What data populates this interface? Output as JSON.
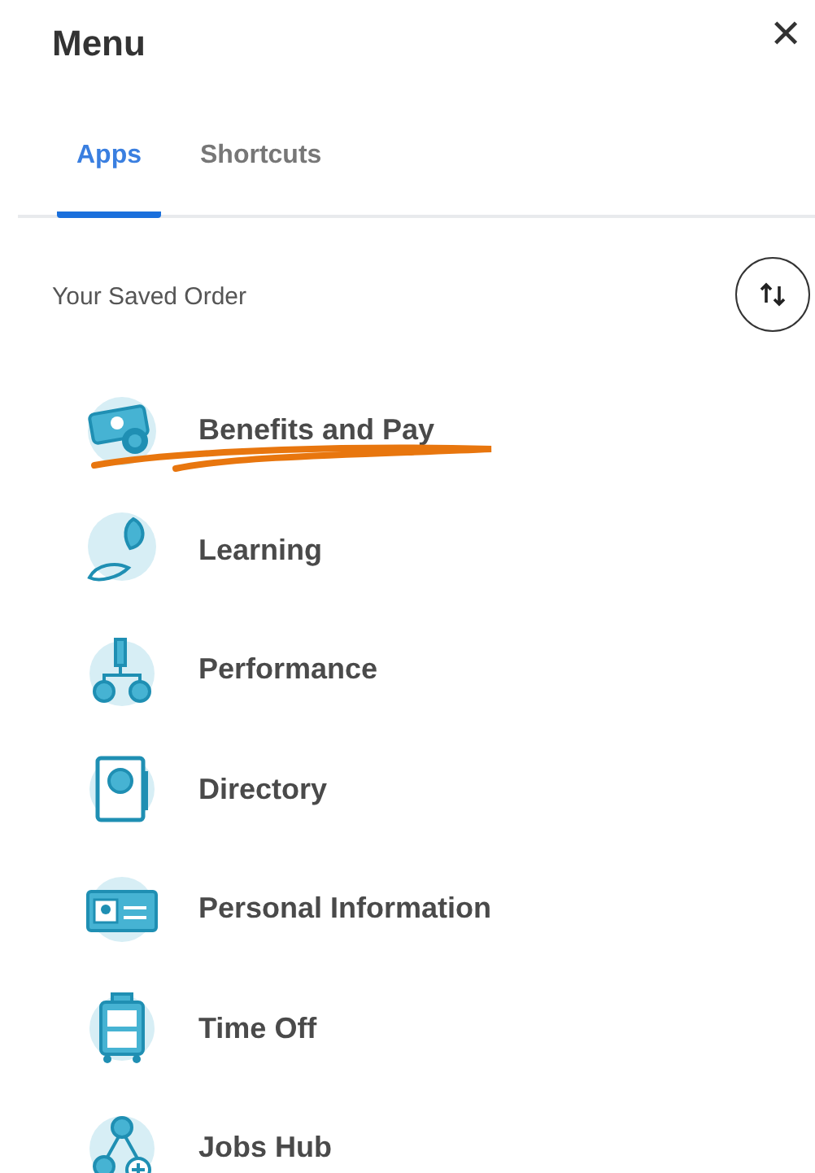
{
  "header": {
    "title": "Menu",
    "close": "✕"
  },
  "tabs": [
    {
      "label": "Apps",
      "selected": true
    },
    {
      "label": "Shortcuts",
      "selected": false
    }
  ],
  "section": {
    "label": "Your Saved Order"
  },
  "apps": [
    {
      "label": "Benefits and Pay",
      "kind": "wallet",
      "underlined": true
    },
    {
      "label": "Learning",
      "kind": "learning",
      "underlined": false
    },
    {
      "label": "Performance",
      "kind": "performance",
      "underlined": false
    },
    {
      "label": "Directory",
      "kind": "directory",
      "underlined": false
    },
    {
      "label": "Personal Information",
      "kind": "idcard",
      "underlined": false
    },
    {
      "label": "Time Off",
      "kind": "suitcase",
      "underlined": false
    },
    {
      "label": "Jobs Hub",
      "kind": "network",
      "underlined": false
    }
  ]
}
